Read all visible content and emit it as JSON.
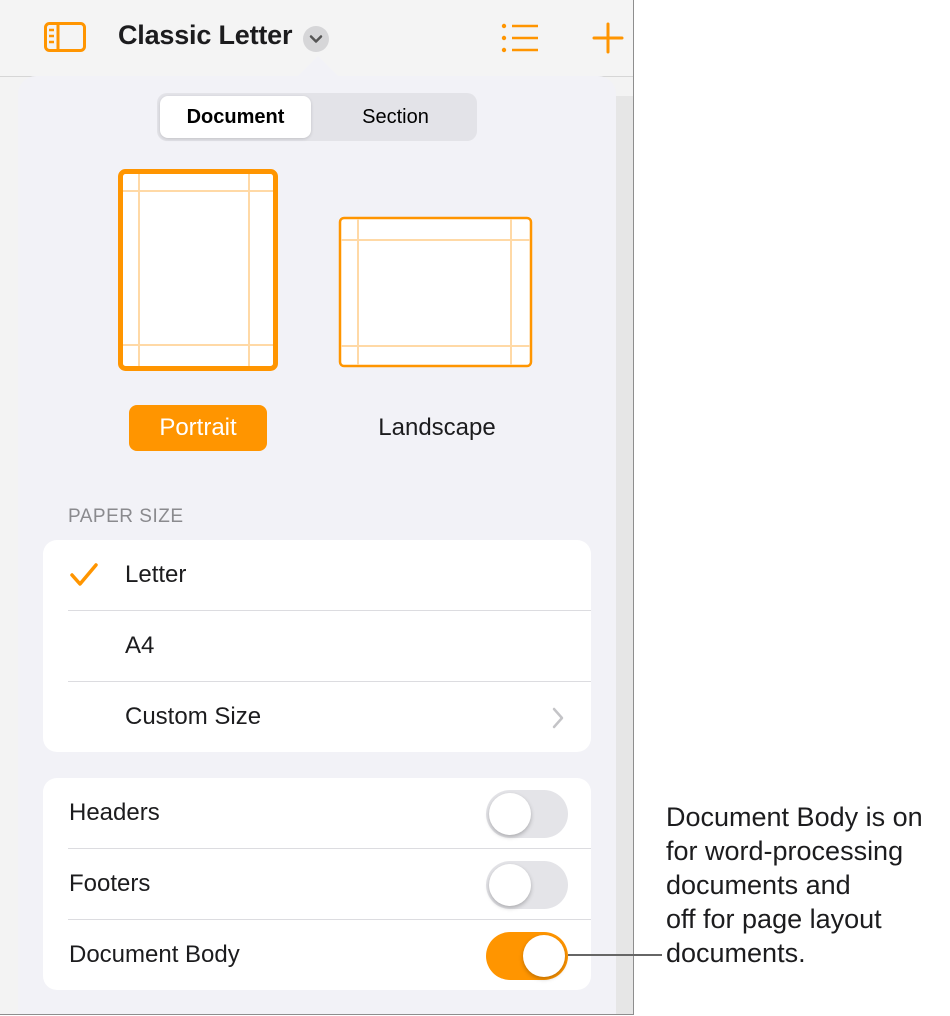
{
  "header": {
    "title": "Classic Letter"
  },
  "segmented": {
    "items": [
      {
        "label": "Document",
        "selected": true
      },
      {
        "label": "Section",
        "selected": false
      }
    ]
  },
  "orientation": {
    "options": [
      {
        "label": "Portrait",
        "selected": true
      },
      {
        "label": "Landscape",
        "selected": false
      }
    ]
  },
  "paper_size": {
    "header": "PAPER SIZE",
    "items": [
      {
        "label": "Letter",
        "checked": true
      },
      {
        "label": "A4",
        "checked": false
      },
      {
        "label": "Custom Size",
        "checked": false
      }
    ]
  },
  "settings": {
    "items": [
      {
        "label": "Headers",
        "on": false
      },
      {
        "label": "Footers",
        "on": false
      },
      {
        "label": "Document Body",
        "on": true
      }
    ]
  },
  "callout": {
    "text": "Document Body is on\nfor word-processing\ndocuments and\noff for page layout\ndocuments."
  },
  "colors": {
    "accent": "#ff9500",
    "toggle_off": "#e4e4e8",
    "secondary_text": "#8a8a8e"
  },
  "icons": {
    "sidebar": "sidebar-icon",
    "title_menu": "chevron-down-icon",
    "list": "list-icon",
    "add": "plus-icon",
    "check": "checkmark-icon",
    "disclosure": "chevron-right-icon"
  }
}
